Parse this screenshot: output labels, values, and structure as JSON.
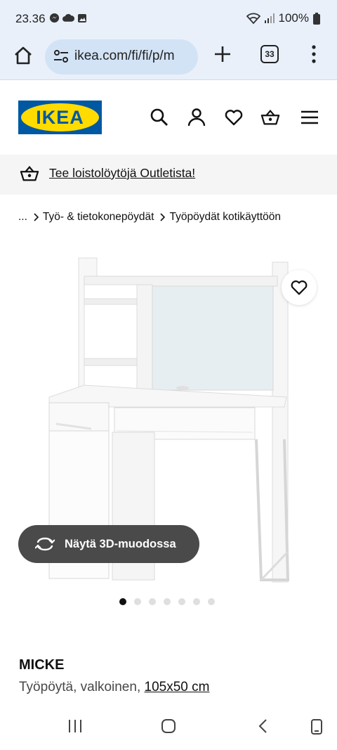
{
  "status": {
    "time": "23.36",
    "battery": "100%",
    "left_icons": [
      "messenger-icon",
      "cloud-icon",
      "image-icon"
    ]
  },
  "browser": {
    "url": "ikea.com/fi/fi/p/m",
    "tab_count": "33"
  },
  "site": {
    "logo_text": "IKEA",
    "brand_blue": "#0058a3",
    "brand_yellow": "#ffdb00",
    "header_icons": [
      "search-icon",
      "account-icon",
      "heart-icon",
      "basket-icon",
      "menu-icon"
    ]
  },
  "promo": {
    "text": "Tee loistolöytöjä Outletista!"
  },
  "breadcrumb": {
    "ellipsis": "...",
    "items": [
      "Työ- & tietokonepöydät",
      "Työpöydät kotikäyttöön"
    ]
  },
  "gallery": {
    "view_3d_label": "Näytä 3D-muodossa",
    "dot_count": 7,
    "active_dot": 0
  },
  "product": {
    "name": "MICKE",
    "description": "Työpöytä, valkoinen,",
    "size": "105x50 cm"
  }
}
